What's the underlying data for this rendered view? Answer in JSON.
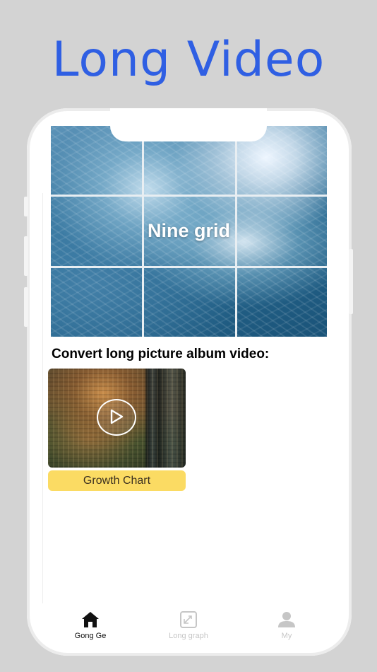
{
  "promo": {
    "title": "Long Video"
  },
  "banner": {
    "label": "Nine grid"
  },
  "section": {
    "heading": "Convert long picture album video:"
  },
  "card": {
    "button_label": "Growth Chart",
    "button_color": "#fbdb63"
  },
  "tabbar": {
    "items": [
      {
        "label": "Gong Ge",
        "icon": "home-icon",
        "active": true
      },
      {
        "label": "Long graph",
        "icon": "expand-frame-icon",
        "active": false
      },
      {
        "label": "My",
        "icon": "person-icon",
        "active": false
      }
    ]
  },
  "colors": {
    "accent": "#2f5fe3",
    "background": "#d3d3d3",
    "tab_active": "#111111",
    "tab_inactive": "#c6c6c6"
  }
}
